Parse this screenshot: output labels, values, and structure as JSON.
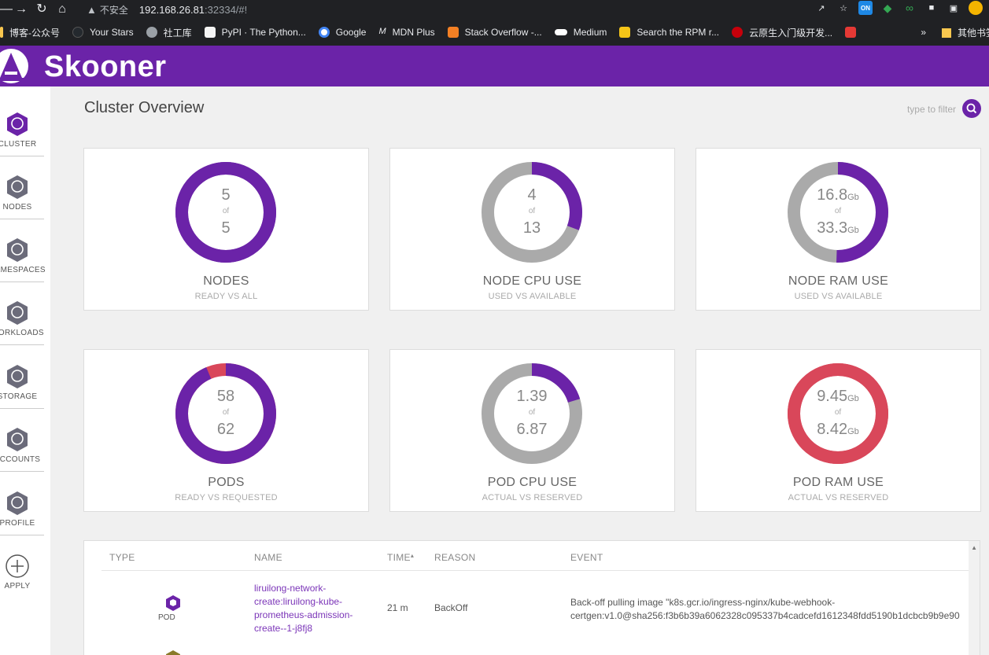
{
  "browser": {
    "security_label": "不安全",
    "url_host": "192.168.26.81",
    "url_rest": ":32334/#!",
    "bookmarks": [
      {
        "label": "博客-公众号",
        "color": "#e8eaed"
      },
      {
        "label": "Your Stars",
        "color": "#24292e"
      },
      {
        "label": "社工库",
        "color": "#9aa0a6"
      },
      {
        "label": "PyPI · The Python...",
        "color": "#f5f5f5"
      },
      {
        "label": "Google",
        "color": "#4285f4"
      },
      {
        "label": "MDN Plus",
        "color": "#202124"
      },
      {
        "label": "Stack Overflow -...",
        "color": "#f48024"
      },
      {
        "label": "Medium",
        "color": "#202124"
      },
      {
        "label": "Search the RPM r...",
        "color": "#f5c518"
      },
      {
        "label": "云原生入门级开发...",
        "color": "#c7000b"
      },
      {
        "label": "",
        "color": "#e53935"
      }
    ],
    "bookmarks_more": "»",
    "other_bookmarks": "其他书签"
  },
  "app": {
    "name": "Skooner",
    "accent": "#6b23a8"
  },
  "sidebar": {
    "items": [
      {
        "label": "CLUSTER",
        "icon": "helm-wheel-icon"
      },
      {
        "label": "NODES",
        "icon": "node-icon"
      },
      {
        "label": "NAMESPACES",
        "icon": "namespace-icon"
      },
      {
        "label": "WORKLOADS",
        "icon": "deploy-icon"
      },
      {
        "label": "STORAGE",
        "icon": "storage-icon"
      },
      {
        "label": "ACCOUNTS",
        "icon": "service-account-icon"
      },
      {
        "label": "PROFILE",
        "icon": "user-icon"
      },
      {
        "label": "APPLY",
        "icon": "plus-circle-icon"
      }
    ]
  },
  "page": {
    "title": "Cluster Overview",
    "filter_placeholder": "type to filter"
  },
  "cards": [
    {
      "title": "NODES",
      "subtitle": "READY VS ALL",
      "top": "5",
      "top_unit": "",
      "of": "of",
      "bottom": "5",
      "bottom_unit": "",
      "fraction": 1.0,
      "color": "#6b23a8",
      "remainder_color": "#6b23a8"
    },
    {
      "title": "NODE CPU USE",
      "subtitle": "USED VS AVAILABLE",
      "top": "4",
      "top_unit": "",
      "of": "of",
      "bottom": "13",
      "bottom_unit": "",
      "fraction": 0.3077,
      "color": "#6b23a8",
      "remainder_color": "#aaaaaa"
    },
    {
      "title": "NODE RAM USE",
      "subtitle": "USED VS AVAILABLE",
      "top": "16.8",
      "top_unit": "Gb",
      "of": "of",
      "bottom": "33.3",
      "bottom_unit": "Gb",
      "fraction": 0.5045,
      "color": "#6b23a8",
      "remainder_color": "#aaaaaa"
    },
    {
      "title": "PODS",
      "subtitle": "READY VS REQUESTED",
      "top": "58",
      "top_unit": "",
      "of": "of",
      "bottom": "62",
      "bottom_unit": "",
      "fraction": 0.9355,
      "color": "#6b23a8",
      "remainder_color": "#d9475a"
    },
    {
      "title": "POD CPU USE",
      "subtitle": "ACTUAL VS RESERVED",
      "top": "1.39",
      "top_unit": "",
      "of": "of",
      "bottom": "6.87",
      "bottom_unit": "",
      "fraction": 0.2023,
      "color": "#6b23a8",
      "remainder_color": "#aaaaaa"
    },
    {
      "title": "POD RAM USE",
      "subtitle": "ACTUAL VS RESERVED",
      "top": "9.45",
      "top_unit": "Gb",
      "of": "of",
      "bottom": "8.42",
      "bottom_unit": "Gb",
      "fraction": 1.0,
      "color": "#d9475a",
      "remainder_color": "#d9475a"
    }
  ],
  "events": {
    "headers": {
      "type": "TYPE",
      "name": "NAME",
      "time": "TIME",
      "time_sort": "▴",
      "reason": "REASON",
      "event": "EVENT"
    },
    "rows": [
      {
        "type": "POD",
        "name": "liruilong-network-create:liruilong-kube-prometheus-admission-create--1-j8fj8",
        "time": "21 m",
        "reason": "BackOff",
        "event_line1": "Back-off pulling image \"k8s.gcr.io/ingress-nginx/kube-webhook-",
        "event_line2": "certgen:v1.0@sha256:f3b6b39a6062328c095337b4cadcefd1612348fdd5190b1dcbcb9b9e90"
      }
    ]
  }
}
